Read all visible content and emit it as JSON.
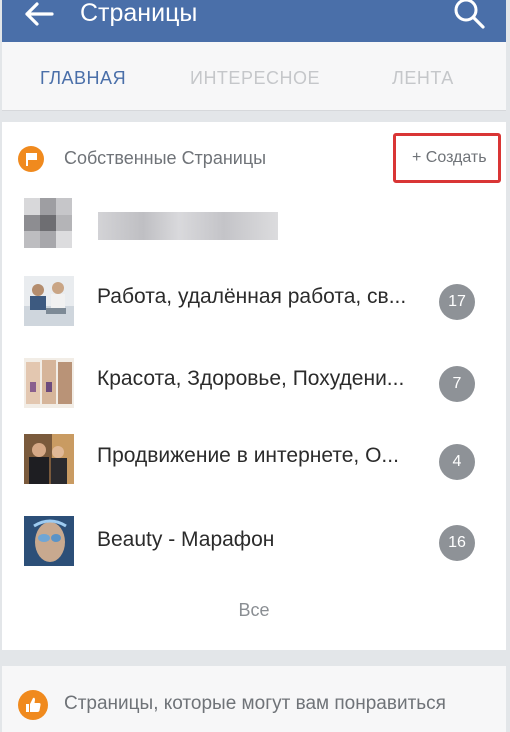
{
  "appbar": {
    "title": "Страницы",
    "back_icon": "arrow-left-icon",
    "search_icon": "search-icon",
    "color": "#4a6fa9"
  },
  "tabs": [
    {
      "label": "ГЛАВНАЯ",
      "active": true
    },
    {
      "label": "ИНТЕРЕСНОЕ",
      "active": false
    },
    {
      "label": "ЛЕНТА",
      "active": false
    }
  ],
  "own_pages": {
    "title": "Собственные Страницы",
    "create_label": "+ Создать",
    "icon": "flag-icon",
    "pages": [
      {
        "label": "Работа, удалённая работа, св...",
        "count": "17"
      },
      {
        "label": "Красота, Здоровье, Похудени...",
        "count": "7"
      },
      {
        "label": "Продвижение в интернете, О...",
        "count": "4"
      },
      {
        "label": "Beauty - Марафон",
        "count": "16"
      }
    ],
    "all_label": "Все"
  },
  "recommended": {
    "title": "Страницы, которые могут вам понравиться",
    "icon": "thumbs-up-icon"
  },
  "colors": {
    "accent": "#4a6fa9",
    "badge": "#f08a1e",
    "highlight": "#d93535",
    "count_bg": "#8e9297"
  }
}
